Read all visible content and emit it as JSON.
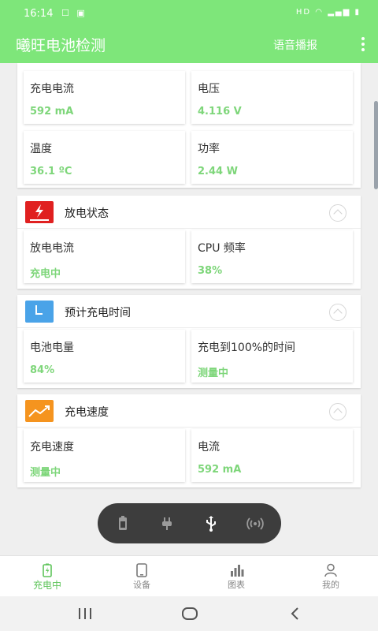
{
  "status_bar": {
    "time": "16:14",
    "right_text": "HD"
  },
  "app_bar": {
    "title": "曦旺电池检测",
    "voice_label": "语音播报"
  },
  "section_top": {
    "cells": [
      {
        "label": "充电电流",
        "value": "592 mA"
      },
      {
        "label": "电压",
        "value": "4.116 V"
      },
      {
        "label": "温度",
        "value": "36.1 ºC"
      },
      {
        "label": "功率",
        "value": "2.44 W"
      }
    ]
  },
  "section_discharge": {
    "title": "放电状态",
    "cells": [
      {
        "label": "放电电流",
        "value": "充电中"
      },
      {
        "label": "CPU 频率",
        "value": "38%"
      }
    ]
  },
  "section_time": {
    "title": "预计充电时间",
    "cells": [
      {
        "label": "电池电量",
        "value": "84%"
      },
      {
        "label": "充电到100%的时间",
        "value": "测量中"
      }
    ]
  },
  "section_speed": {
    "title": "充电速度",
    "cells": [
      {
        "label": "充电速度",
        "value": "测量中"
      },
      {
        "label": "电流",
        "value": "592 mA"
      }
    ]
  },
  "bottom_nav": {
    "items": [
      {
        "label": "充电中"
      },
      {
        "label": "设备"
      },
      {
        "label": "图表"
      },
      {
        "label": "我的"
      }
    ]
  },
  "colors": {
    "accent": "#7ee67a",
    "value_green": "#7ed67a",
    "discharge_icon": "#e02020",
    "clock_icon": "#4aa3e8",
    "speed_icon": "#f5941f"
  },
  "icons": [
    "battery-icon",
    "plug-icon",
    "usb-icon",
    "wireless-icon",
    "charging-tab-icon",
    "device-tab-icon",
    "chart-tab-icon",
    "profile-tab-icon"
  ]
}
